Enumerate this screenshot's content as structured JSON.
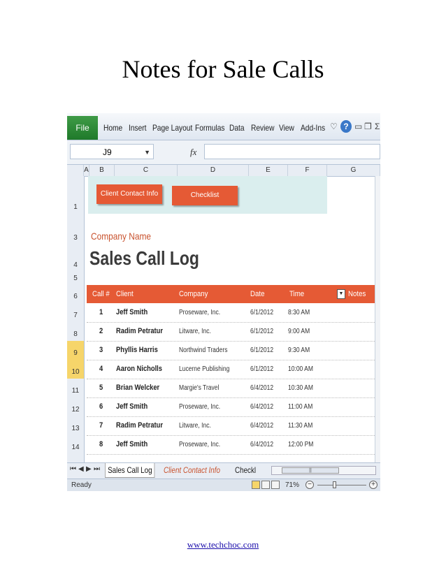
{
  "document": {
    "title": "Notes for Sale Calls",
    "footer_link": "www.techchoc.com"
  },
  "ribbon": {
    "file_tab": "File",
    "tabs": [
      "Home",
      "Insert",
      "Page Layout",
      "Formulas",
      "Data",
      "Review",
      "View",
      "Add-Ins"
    ],
    "help_label": "?"
  },
  "formula_bar": {
    "name_box": "J9",
    "fx_label": "fx",
    "formula": ""
  },
  "columns": [
    "A",
    "B",
    "C",
    "D",
    "E",
    "F",
    "G"
  ],
  "rows": [
    "1",
    "3",
    "4",
    "5",
    "6",
    "7",
    "8",
    "9",
    "10",
    "11",
    "12",
    "13",
    "14"
  ],
  "selected_rows": [
    "9",
    "10"
  ],
  "sheet": {
    "buttons": [
      "Client Contact Info",
      "Checklist"
    ],
    "company_name": "Company Name",
    "log_title": "Sales Call Log",
    "table": {
      "headers": [
        "Call #",
        "Client",
        "Company",
        "Date",
        "Time",
        "Notes"
      ],
      "filter_icon": "▼",
      "rows": [
        {
          "call": "1",
          "client": "Jeff Smith",
          "company": "Proseware, Inc.",
          "date": "6/1/2012",
          "time": "8:30 AM"
        },
        {
          "call": "2",
          "client": "Radim Petratur",
          "company": "Litware, Inc.",
          "date": "6/1/2012",
          "time": "9:00 AM"
        },
        {
          "call": "3",
          "client": "Phyllis Harris",
          "company": "Northwind Traders",
          "date": "6/1/2012",
          "time": "9:30 AM"
        },
        {
          "call": "4",
          "client": "Aaron Nicholls",
          "company": "Lucerne Publishing",
          "date": "6/1/2012",
          "time": "10:00 AM"
        },
        {
          "call": "5",
          "client": "Brian Welcker",
          "company": "Margie's Travel",
          "date": "6/4/2012",
          "time": "10:30 AM"
        },
        {
          "call": "6",
          "client": "Jeff Smith",
          "company": "Proseware, Inc.",
          "date": "6/4/2012",
          "time": "11:00 AM"
        },
        {
          "call": "7",
          "client": "Radim Petratur",
          "company": "Litware, Inc.",
          "date": "6/4/2012",
          "time": "11:30 AM"
        },
        {
          "call": "8",
          "client": "Jeff Smith",
          "company": "Proseware, Inc.",
          "date": "6/4/2012",
          "time": "12:00 PM"
        }
      ]
    }
  },
  "sheet_tabs": {
    "active": "Sales Call Log",
    "others": [
      "Client Contact Info",
      "Checkl"
    ]
  },
  "status_bar": {
    "status": "Ready",
    "zoom": "71%",
    "zoom_minus": "−",
    "zoom_plus": "+",
    "zoom_level": 0.71
  },
  "colors": {
    "accent": "#e55a35",
    "file_tab": "#2e8b39",
    "nav_band": "#daeeee"
  }
}
